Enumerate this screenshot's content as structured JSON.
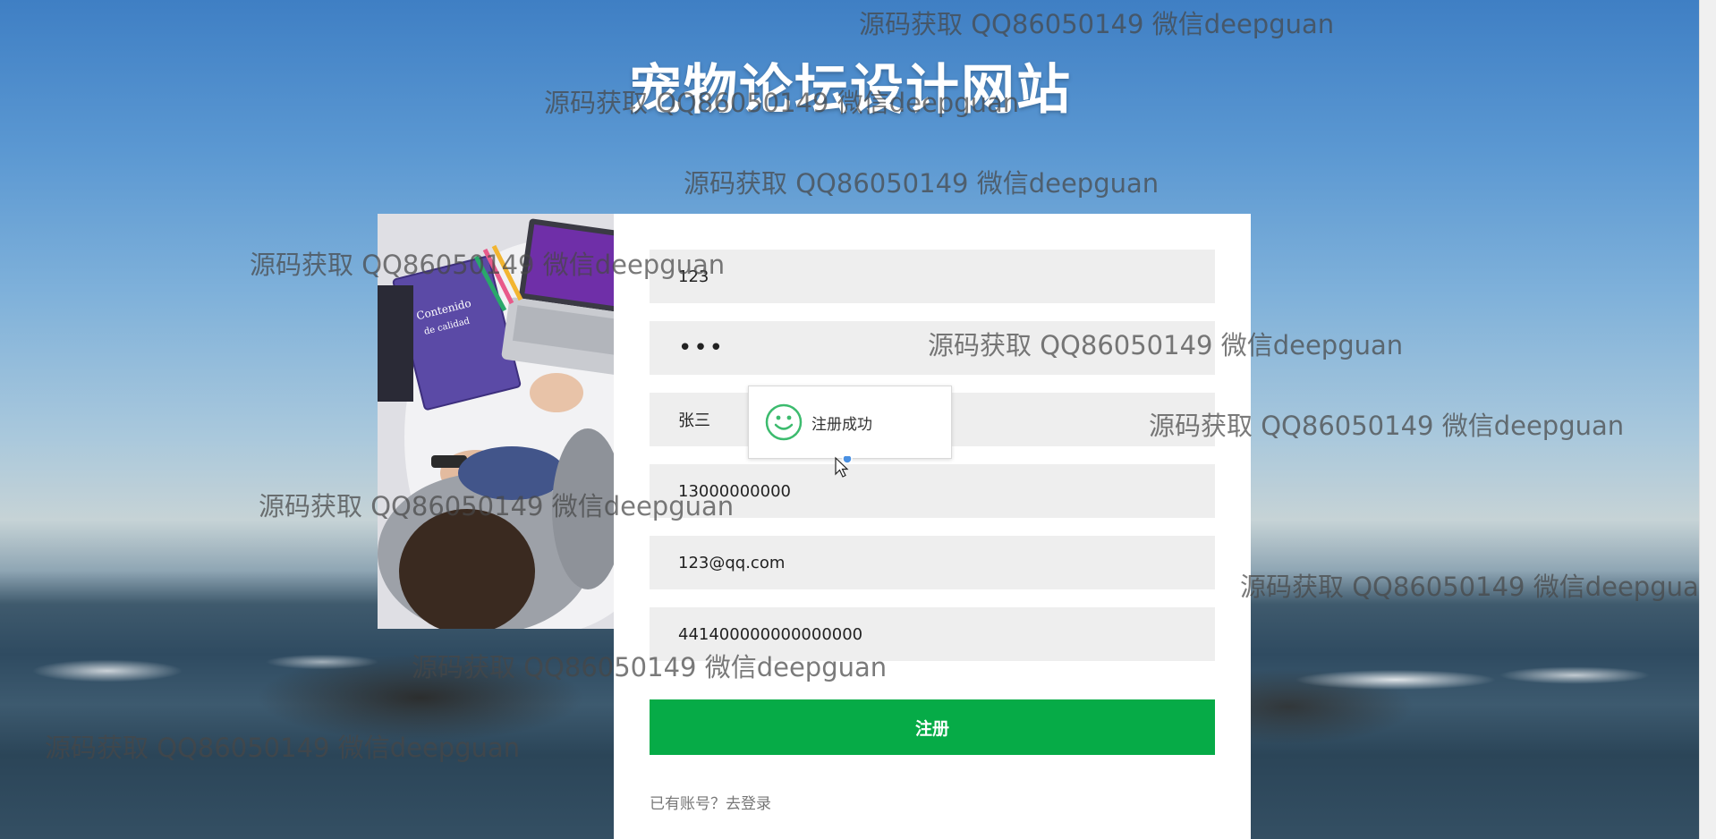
{
  "site": {
    "title": "宠物论坛设计网站"
  },
  "form": {
    "account": "123",
    "password_mask": "•••",
    "name": "张三",
    "phone": "13000000000",
    "email": "123@qq.com",
    "id_number": "441400000000000000",
    "submit_label": "注册",
    "login_prompt": "已有账号？去登录"
  },
  "toast": {
    "message": "注册成功",
    "icon": "smile-icon"
  },
  "watermark": {
    "text": "源码获取 QQ86050149 微信deepguan"
  },
  "colors": {
    "primary_button": "#06ab47",
    "field_background": "#eeeeee",
    "toast_icon": "#3cbb6e"
  }
}
